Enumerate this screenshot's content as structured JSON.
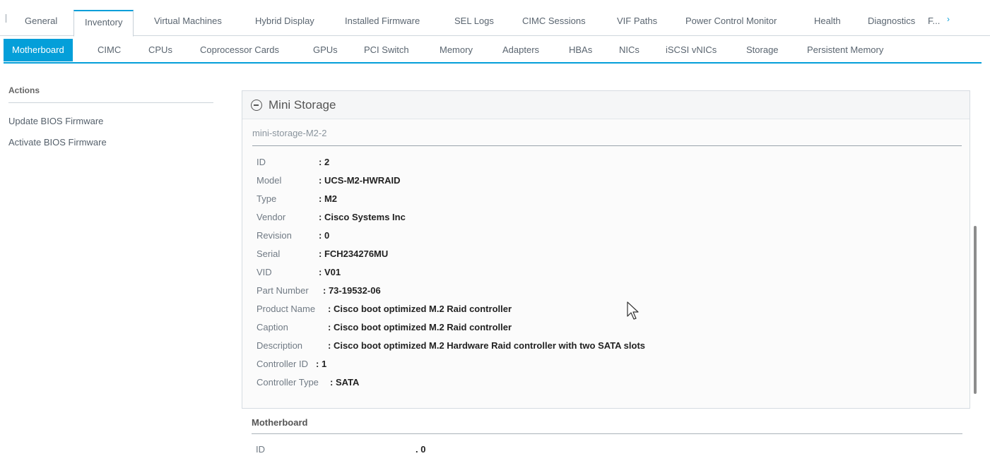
{
  "top_tabs": [
    {
      "label": "General"
    },
    {
      "label": "Inventory"
    },
    {
      "label": "Virtual Machines"
    },
    {
      "label": "Hybrid Display"
    },
    {
      "label": "Installed Firmware"
    },
    {
      "label": "SEL Logs"
    },
    {
      "label": "CIMC Sessions"
    },
    {
      "label": "VIF Paths"
    },
    {
      "label": "Power Control Monitor"
    },
    {
      "label": "Health"
    },
    {
      "label": "Diagnostics"
    },
    {
      "label": "F..."
    }
  ],
  "top_scroll_glyph": "›",
  "active_top_tab": "Inventory",
  "sub_tabs": [
    {
      "label": "Motherboard"
    },
    {
      "label": "CIMC"
    },
    {
      "label": "CPUs"
    },
    {
      "label": "Coprocessor Cards"
    },
    {
      "label": "GPUs"
    },
    {
      "label": "PCI Switch"
    },
    {
      "label": "Memory"
    },
    {
      "label": "Adapters"
    },
    {
      "label": "HBAs"
    },
    {
      "label": "NICs"
    },
    {
      "label": "iSCSI vNICs"
    },
    {
      "label": "Storage"
    },
    {
      "label": "Persistent Memory"
    }
  ],
  "active_sub_tab": "Motherboard",
  "actions": {
    "title": "Actions",
    "items": [
      "Update BIOS Firmware",
      "Activate BIOS Firmware"
    ]
  },
  "mini_storage": {
    "title": "Mini Storage",
    "subtitle": "mini-storage-M2-2",
    "properties": [
      {
        "label": "ID",
        "value": "2"
      },
      {
        "label": "Model",
        "value": "UCS-M2-HWRAID"
      },
      {
        "label": "Type",
        "value": "M2"
      },
      {
        "label": "Vendor",
        "value": "Cisco Systems Inc"
      },
      {
        "label": "Revision",
        "value": "0"
      },
      {
        "label": "Serial",
        "value": "FCH234276MU"
      },
      {
        "label": "VID",
        "value": "V01"
      },
      {
        "label": "Part Number",
        "value": "73-19532-06"
      },
      {
        "label": "Product Name",
        "value": "Cisco boot optimized M.2 Raid controller"
      },
      {
        "label": "Caption",
        "value": "Cisco boot optimized M.2 Raid controller"
      },
      {
        "label": "Description",
        "value": "Cisco boot optimized M.2 Hardware Raid controller with two SATA slots"
      },
      {
        "label": "Controller ID",
        "value": "1"
      },
      {
        "label": "Controller Type",
        "value": "SATA"
      }
    ]
  },
  "motherboard": {
    "title": "Motherboard",
    "id_label": "ID",
    "id_value": "0"
  },
  "colors": {
    "accent": "#049fd9"
  }
}
